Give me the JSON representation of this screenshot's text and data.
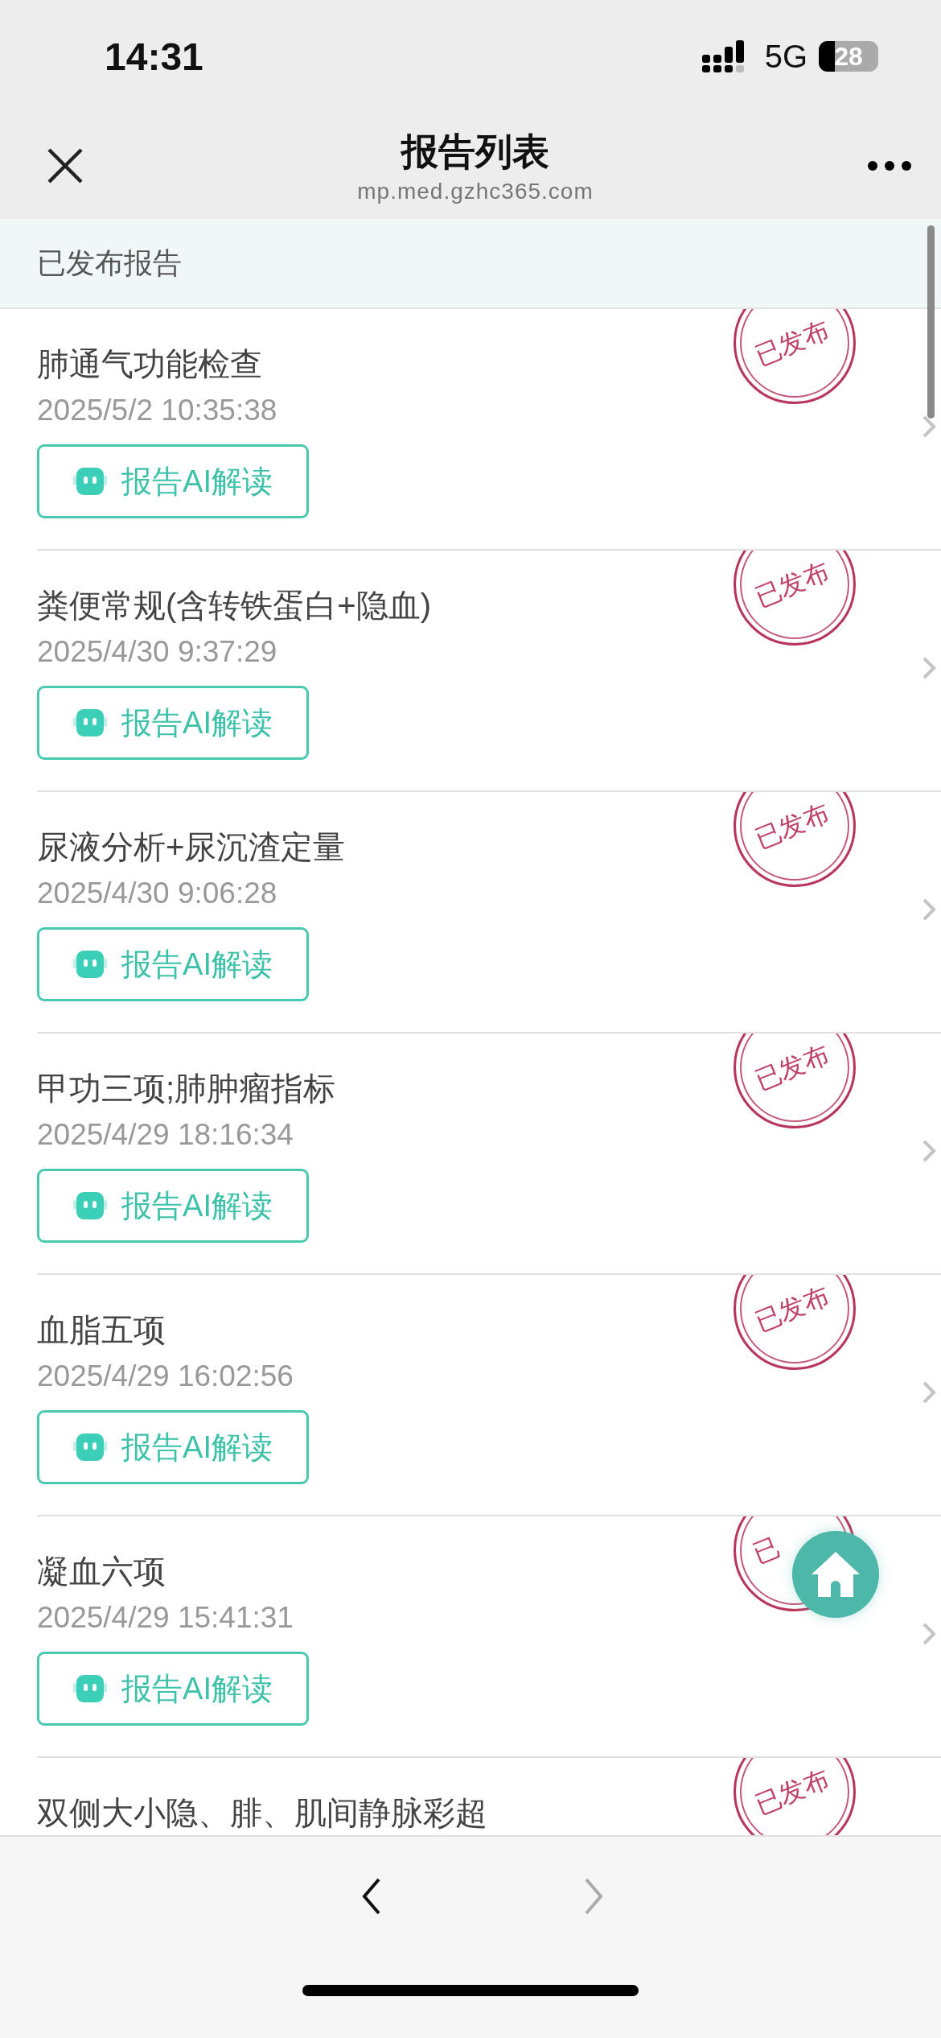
{
  "status_bar": {
    "time": "14:31",
    "network": "5G",
    "battery": "28"
  },
  "nav_bar": {
    "title": "报告列表",
    "url": "mp.med.gzhc365.com"
  },
  "section": {
    "title": "已发布报告"
  },
  "reports": [
    {
      "title": "肺通气功能检查",
      "date": "2025/5/2 10:35:38",
      "button": "报告AI解读",
      "stamp": "已发布"
    },
    {
      "title": "粪便常规(含转铁蛋白+隐血)",
      "date": "2025/4/30 9:37:29",
      "button": "报告AI解读",
      "stamp": "已发布"
    },
    {
      "title": "尿液分析+尿沉渣定量",
      "date": "2025/4/30 9:06:28",
      "button": "报告AI解读",
      "stamp": "已发布"
    },
    {
      "title": "甲功三项;肺肿瘤指标",
      "date": "2025/4/29 18:16:34",
      "button": "报告AI解读",
      "stamp": "已发布"
    },
    {
      "title": "血脂五项",
      "date": "2025/4/29 16:02:56",
      "button": "报告AI解读",
      "stamp": "已发布"
    },
    {
      "title": "凝血六项",
      "date": "2025/4/29 15:41:31",
      "button": "报告AI解读",
      "stamp": "已"
    },
    {
      "title": "双侧大小隐、腓、肌间静脉彩超",
      "stamp": "已发布"
    }
  ],
  "toolbar": {
    "back": {
      "disabled": false
    },
    "forward": {
      "disabled": true
    }
  }
}
